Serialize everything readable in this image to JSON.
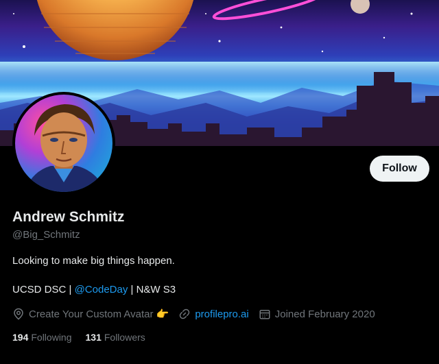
{
  "profile": {
    "name": "Andrew Schmitz",
    "handle": "@Big_Schmitz",
    "bio_line1": "Looking to make big things happen.",
    "bio_line2_prefix": "UCSD DSC |",
    "bio_line2_link": "@CodeDay",
    "bio_line2_suffix": "| N&W S3"
  },
  "actions": {
    "follow_label": "Follow"
  },
  "meta": {
    "location": "Create Your Custom Avatar 👉",
    "website": "profilepro.ai",
    "joined": "Joined February 2020"
  },
  "stats": {
    "following_count": "194",
    "following_label": "Following",
    "followers_count": "131",
    "followers_label": "Followers"
  },
  "colors": {
    "accent": "#1d9bf0",
    "muted": "#71767b",
    "text": "#e7e9ea",
    "background": "#000000"
  }
}
